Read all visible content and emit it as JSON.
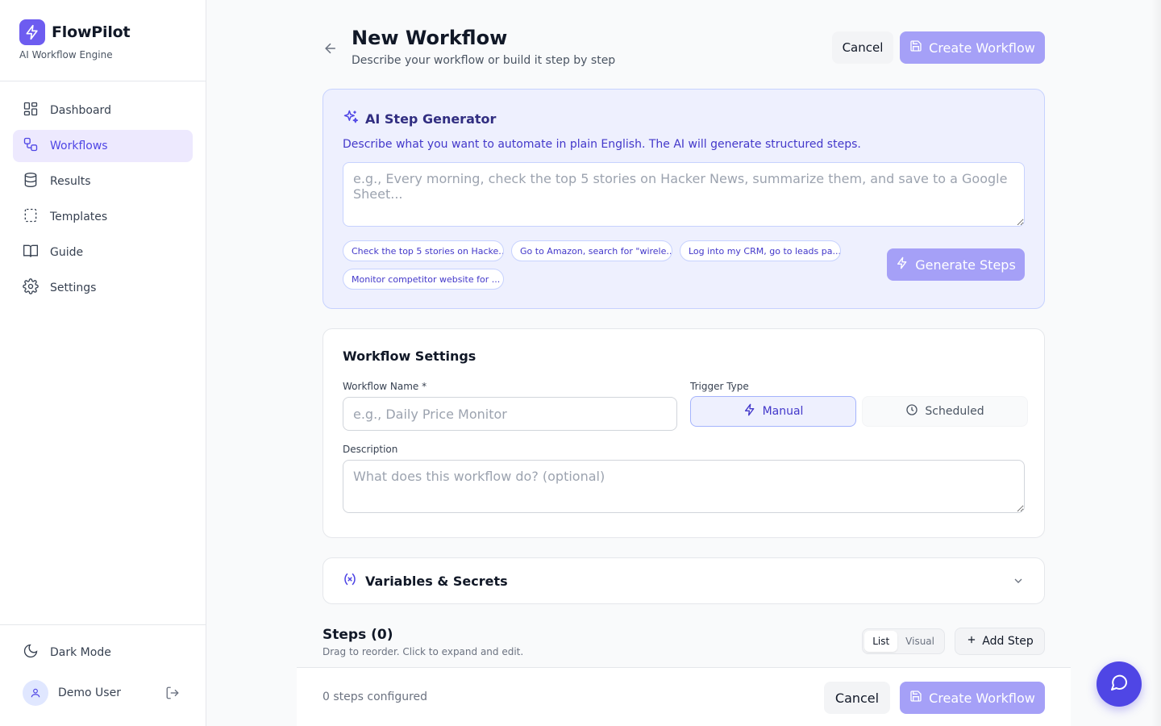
{
  "app": {
    "name": "FlowPilot",
    "tagline": "AI Workflow Engine"
  },
  "sidebar": {
    "items": [
      {
        "label": "Dashboard",
        "icon": "dashboard-icon"
      },
      {
        "label": "Workflows",
        "icon": "workflow-icon",
        "active": true
      },
      {
        "label": "Results",
        "icon": "database-icon"
      },
      {
        "label": "Templates",
        "icon": "template-icon"
      },
      {
        "label": "Guide",
        "icon": "book-icon"
      },
      {
        "label": "Settings",
        "icon": "gear-icon"
      }
    ],
    "dark_mode_label": "Dark Mode",
    "user_name": "Demo User"
  },
  "header": {
    "title": "New Workflow",
    "subtitle": "Describe your workflow or build it step by step",
    "cancel_label": "Cancel",
    "create_label": "Create Workflow"
  },
  "ai_generator": {
    "title": "AI Step Generator",
    "description": "Describe what you want to automate in plain English. The AI will generate structured steps.",
    "placeholder": "e.g., Every morning, check the top 5 stories on Hacker News, summarize them, and save to a Google Sheet...",
    "suggestions": [
      "Check the top 5 stories on Hacke...",
      "Go to Amazon, search for \"wirele...",
      "Log into my CRM, go to leads pa...",
      "Monitor competitor website for ..."
    ],
    "generate_label": "Generate Steps"
  },
  "settings": {
    "title": "Workflow Settings",
    "name_label": "Workflow Name *",
    "name_placeholder": "e.g., Daily Price Monitor",
    "trigger_label": "Trigger Type",
    "trigger_manual": "Manual",
    "trigger_scheduled": "Scheduled",
    "description_label": "Description",
    "description_placeholder": "What does this workflow do? (optional)"
  },
  "variables": {
    "title": "Variables & Secrets"
  },
  "steps": {
    "title": "Steps (0)",
    "subtitle": "Drag to reorder. Click to expand and edit.",
    "view_list": "List",
    "view_visual": "Visual",
    "add_label": "Add Step"
  },
  "footer": {
    "count_text": "0 steps configured",
    "cancel_label": "Cancel",
    "create_label": "Create Workflow"
  },
  "colors": {
    "accent": "#4f46e5",
    "accent_disabled": "#a5a0f7",
    "ai_panel_bg": "#eef0fe"
  }
}
